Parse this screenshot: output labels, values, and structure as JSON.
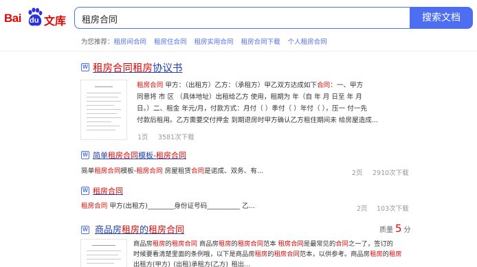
{
  "header": {
    "logo": {
      "part1": "Bai",
      "paw": "du",
      "part2": "文库"
    },
    "search": {
      "value": "租房合同",
      "button_label": "搜索文档"
    }
  },
  "recommend": {
    "label": "为您推荐：",
    "items": [
      "租房间合同",
      "租房住合同",
      "租房实用合同",
      "租房合同下载",
      "个人租房合同"
    ]
  },
  "results": [
    {
      "icon": "W",
      "title": [
        {
          "t": "租房合同租房",
          "h": true
        },
        {
          "t": "协议书",
          "h": false
        }
      ],
      "lines": [
        [
          {
            "t": "租房合同",
            "h": true
          },
          {
            "t": " 甲方：（出租方）乙方：（承租方）甲乙双方达成如下",
            "h": false
          },
          {
            "t": "合同",
            "h": true
          },
          {
            "t": "：一、甲方",
            "h": false
          }
        ],
        [
          {
            "t": "同意将 市 区 （具体地址）出租给乙方 使用，租期为 年（自 年 月 日至 年 月",
            "h": false
          }
        ],
        [
          {
            "t": "日。）二、租金 年元/月，付款方式：月付（ ）季付（ ）年付（ ），压一 付一先",
            "h": false
          }
        ],
        [
          {
            "t": "付款后租用。乙方需要交付押金 到期退房时甲方确认乙方租住期间未 给房屋造成...",
            "h": false
          }
        ]
      ],
      "pages": "1页",
      "downloads": "3581次下载"
    },
    {
      "icon": "W",
      "title": [
        {
          "t": "简单",
          "h": false
        },
        {
          "t": "租房合同",
          "h": true
        },
        {
          "t": "模板-",
          "h": false
        },
        {
          "t": "租房合同",
          "h": true
        }
      ],
      "lines": [
        [
          {
            "t": "简单",
            "h": false
          },
          {
            "t": "租房合同",
            "h": true
          },
          {
            "t": "模板-",
            "h": false
          },
          {
            "t": "租房合同",
            "h": true
          },
          {
            "t": " 房屋租赁",
            "h": false
          },
          {
            "t": "合同",
            "h": true
          },
          {
            "t": "是诺成、双务、有...",
            "h": false
          }
        ]
      ],
      "pages": "2页",
      "downloads": "2910次下载"
    },
    {
      "icon": "W",
      "title": [
        {
          "t": "租房合同",
          "h": true
        }
      ],
      "lines": [
        [
          {
            "t": "租房合同",
            "h": true
          },
          {
            "t": " 甲方(出租方)________身份证号码__________ 乙...",
            "h": false
          }
        ]
      ],
      "pages": "2页",
      "downloads": "103次下载"
    },
    {
      "icon": "W",
      "title": [
        {
          "t": "商品房",
          "h": false
        },
        {
          "t": "租房",
          "h": true
        },
        {
          "t": "的",
          "h": false
        },
        {
          "t": "租房合同",
          "h": true
        }
      ],
      "lines": [
        [
          {
            "t": "商品房",
            "h": false
          },
          {
            "t": "租房",
            "h": true
          },
          {
            "t": "的",
            "h": false
          },
          {
            "t": "租房合同",
            "h": true
          },
          {
            "t": " 商品房",
            "h": false
          },
          {
            "t": "租房",
            "h": true
          },
          {
            "t": "的",
            "h": false
          },
          {
            "t": "租房合同",
            "h": true
          },
          {
            "t": "范本 ",
            "h": false
          },
          {
            "t": "租房合同",
            "h": true
          },
          {
            "t": "是最常见的",
            "h": false
          },
          {
            "t": "合同",
            "h": true
          },
          {
            "t": "之一了，签订的",
            "h": false
          }
        ],
        [
          {
            "t": "时候要看清楚里面的条例哦，以下是商品房",
            "h": false
          },
          {
            "t": "租房",
            "h": true
          },
          {
            "t": "的",
            "h": false
          },
          {
            "t": "租房合同",
            "h": true
          },
          {
            "t": "范本，以供参考。商品房",
            "h": false
          },
          {
            "t": "租房",
            "h": true
          },
          {
            "t": "的",
            "h": false
          },
          {
            "t": "租房",
            "h": true
          }
        ],
        [
          {
            "t": "出租方(甲方)_(出租)承租方(乙方)_租出...",
            "h": false
          }
        ]
      ],
      "quality_label": "质量",
      "quality_value": "5",
      "quality_unit": "分"
    }
  ],
  "colors": {
    "brand": "#e10602",
    "accent": "#4e6ef2",
    "link": "#2440b3",
    "meta": "#999999"
  }
}
